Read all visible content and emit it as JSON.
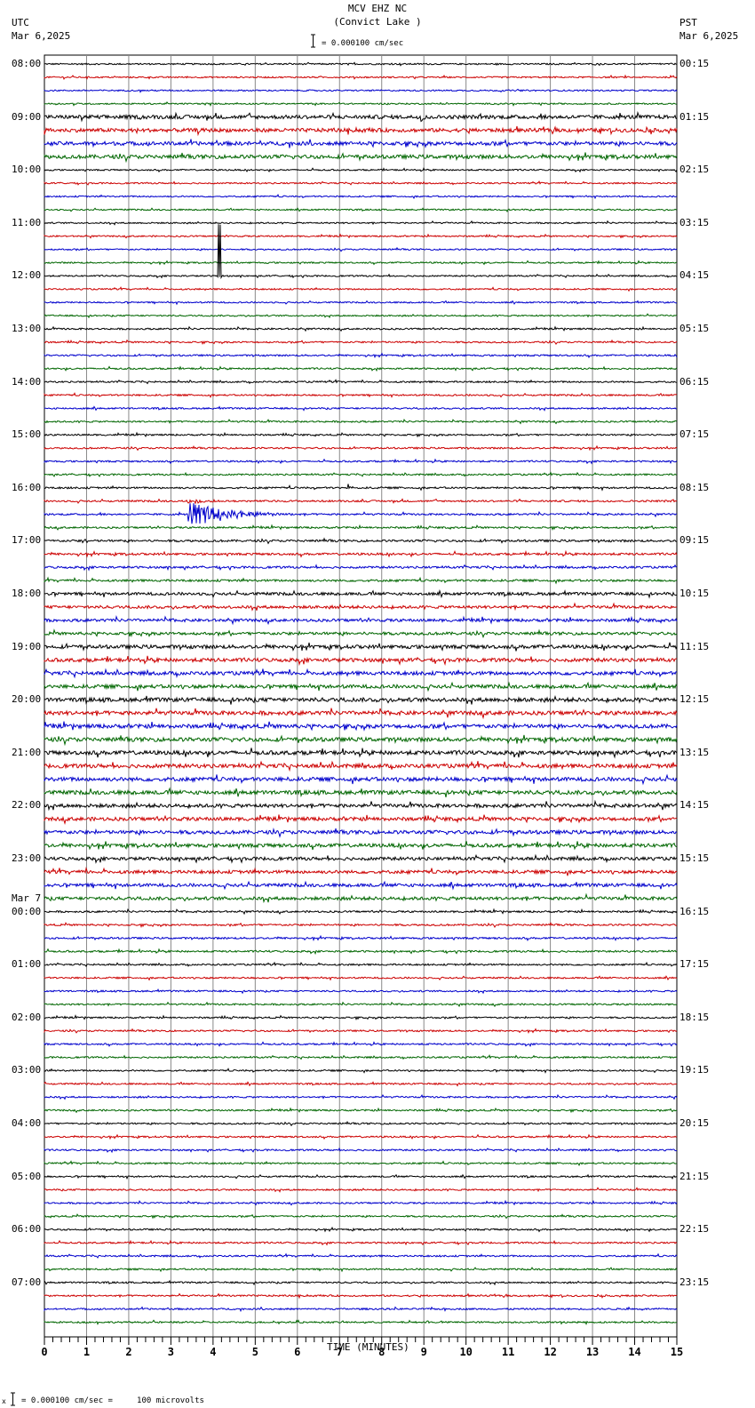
{
  "header": {
    "station": "MCV EHZ NC",
    "location": "(Convict Lake )",
    "left_tz": "UTC",
    "left_date": "Mar 6,2025",
    "right_tz": "PST",
    "right_date": "Mar 6,2025",
    "scale": "= 0.000100 cm/sec"
  },
  "footer": {
    "scale": "= 0.000100 cm/sec =     100 microvolts",
    "mark": "x"
  },
  "chart_data": {
    "type": "line",
    "title": "MCV EHZ NC (Convict Lake )",
    "xlabel": "TIME (MINUTES)",
    "xlim": [
      0,
      15
    ],
    "x_ticks": [
      "0",
      "1",
      "2",
      "3",
      "4",
      "5",
      "6",
      "7",
      "8",
      "9",
      "10",
      "11",
      "12",
      "13",
      "14",
      "15"
    ],
    "traces_per_hour": 4,
    "trace_count": 96,
    "trace_colors": [
      "#000000",
      "#cc0000",
      "#0000cc",
      "#006600"
    ],
    "left_labels": [
      "08:00",
      "09:00",
      "10:00",
      "11:00",
      "12:00",
      "13:00",
      "14:00",
      "15:00",
      "16:00",
      "17:00",
      "18:00",
      "19:00",
      "20:00",
      "21:00",
      "22:00",
      "23:00",
      "00:00",
      "01:00",
      "02:00",
      "03:00",
      "04:00",
      "05:00",
      "06:00",
      "07:00"
    ],
    "left_date_change": {
      "hour_index": 16,
      "label": "Mar 7"
    },
    "right_labels": [
      "00:15",
      "01:15",
      "02:15",
      "03:15",
      "04:15",
      "05:15",
      "06:15",
      "07:15",
      "08:15",
      "09:15",
      "10:15",
      "11:15",
      "12:15",
      "13:15",
      "14:15",
      "15:15",
      "16:15",
      "17:15",
      "18:15",
      "19:15",
      "20:15",
      "21:15",
      "22:15",
      "23:15"
    ],
    "noise_by_hour": [
      0.8,
      1.6,
      0.8,
      0.8,
      0.8,
      0.9,
      0.9,
      0.9,
      1.0,
      1.2,
      1.6,
      2.0,
      2.2,
      2.2,
      2.0,
      1.8,
      1.0,
      0.9,
      0.9,
      0.9,
      0.9,
      0.9,
      0.9,
      0.9
    ],
    "events": [
      {
        "trace": 16,
        "minute": 4.1,
        "amplitude": 58,
        "duration": 0.1,
        "type": "spike"
      },
      {
        "trace": 34,
        "minute": 3.4,
        "amplitude": 16,
        "duration": 2.6,
        "type": "quake"
      },
      {
        "trace": 33,
        "minute": 3.4,
        "amplitude": 4,
        "duration": 1.0,
        "type": "quake"
      },
      {
        "trace": 32,
        "minute": 7.2,
        "amplitude": 5,
        "duration": 0.2,
        "type": "quake"
      },
      {
        "trace": 36,
        "minute": 0.9,
        "amplitude": 6,
        "duration": 0.2,
        "type": "quake"
      },
      {
        "trace": 4,
        "minute": 8.9,
        "amplitude": 5,
        "duration": 0.3,
        "type": "quake"
      },
      {
        "trace": 6,
        "minute": 7.2,
        "amplitude": 4,
        "duration": 0.4,
        "type": "quake"
      },
      {
        "trace": 93,
        "minute": 4.6,
        "amplitude": 6,
        "duration": 0.1,
        "type": "quake"
      }
    ]
  }
}
